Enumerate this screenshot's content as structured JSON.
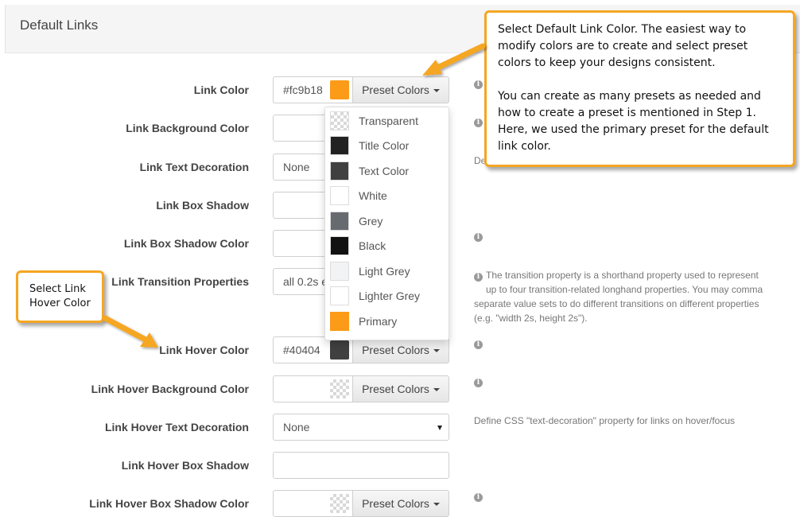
{
  "section": {
    "title": "Default Links"
  },
  "fields": {
    "link_color": {
      "label": "Link Color",
      "value": "#fc9b18",
      "swatch": "#fc9b18",
      "button": "Preset Colors"
    },
    "link_bg_color": {
      "label": "Link Background Color"
    },
    "link_text_decoration": {
      "label": "Link Text Decoration",
      "value": "None",
      "help": "De"
    },
    "link_box_shadow": {
      "label": "Link Box Shadow"
    },
    "link_box_shadow_color": {
      "label": "Link Box Shadow Color"
    },
    "link_transition": {
      "label": "Link Transition Properties",
      "value": "all 0.2s e",
      "help": [
        "The transition property is a shorthand property used to represent",
        "up to four transition-related longhand properties. You may comma",
        "separate value sets to do different transitions on different properties",
        "(e.g. \"width 2s, height 2s\")."
      ]
    },
    "link_hover_color": {
      "label": "Link Hover Color",
      "value": "#40404",
      "swatch": "#404040",
      "button": "Preset Colors"
    },
    "link_hover_bg_color": {
      "label": "Link Hover Background Color",
      "button": "Preset Colors"
    },
    "link_hover_text_decoration": {
      "label": "Link Hover Text Decoration",
      "value": "None",
      "help": "Define CSS \"text-decoration\" property for links on hover/focus"
    },
    "link_hover_box_shadow": {
      "label": "Link Hover Box Shadow"
    },
    "link_hover_box_shadow_color": {
      "label": "Link Hover Box Shadow Color",
      "button": "Preset Colors"
    }
  },
  "info_glyph": "i",
  "preset_dropdown": {
    "items": [
      {
        "label": "Transparent",
        "color": "transparent"
      },
      {
        "label": "Title Color",
        "color": "#222222"
      },
      {
        "label": "Text Color",
        "color": "#404040"
      },
      {
        "label": "White",
        "color": "#ffffff"
      },
      {
        "label": "Grey",
        "color": "#676b70"
      },
      {
        "label": "Black",
        "color": "#111111"
      },
      {
        "label": "Light Grey",
        "color": "#f1f3f4"
      },
      {
        "label": "Lighter Grey",
        "color": "#ffffff"
      },
      {
        "label": "Primary",
        "color": "#fc9b18"
      }
    ]
  },
  "callouts": {
    "main": {
      "p1": "Select Default Link Color. The easiest way to modify colors are to create and select preset colors to keep your designs consistent.",
      "p2": "You can create as many presets as needed and how to create a preset is mentioned in Step 1. Here, we used the primary preset for the default link color."
    },
    "hover": {
      "line1": "Select Link",
      "line2": "Hover Color"
    }
  },
  "colors": {
    "accent": "#f5a623",
    "primary": "#fc9b18"
  }
}
